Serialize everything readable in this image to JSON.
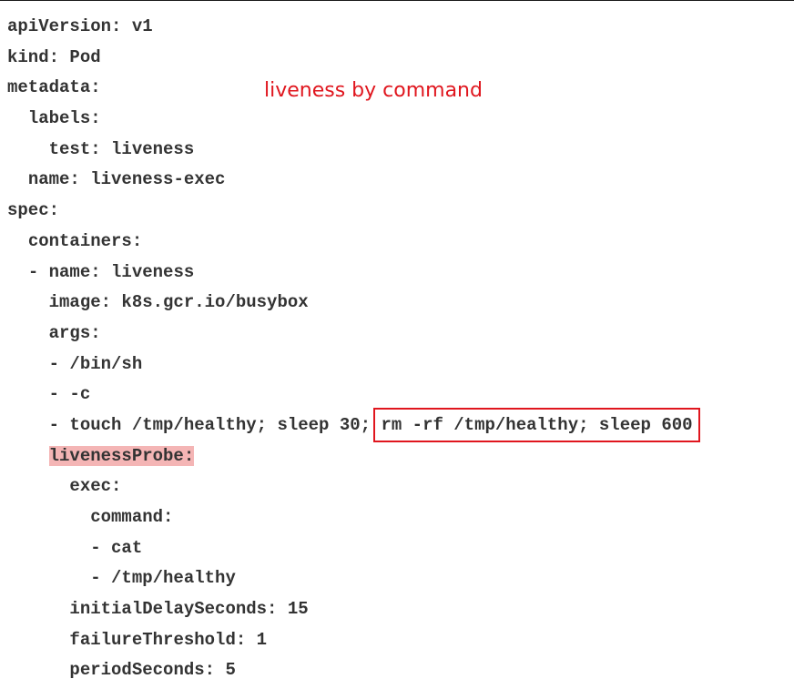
{
  "annotation": {
    "text": "liveness by command",
    "color": "#e0161e"
  },
  "code": {
    "lines": [
      {
        "indent": "",
        "text": "apiVersion: v1"
      },
      {
        "indent": "",
        "text": "kind: Pod"
      },
      {
        "indent": "",
        "text": "metadata:"
      },
      {
        "indent": "  ",
        "text": "labels:"
      },
      {
        "indent": "    ",
        "text": "test: liveness"
      },
      {
        "indent": "  ",
        "text": "name: liveness-exec"
      },
      {
        "indent": "",
        "text": "spec:"
      },
      {
        "indent": "  ",
        "text": "containers:"
      },
      {
        "indent": "  ",
        "text": "- name: liveness"
      },
      {
        "indent": "    ",
        "text": "image: k8s.gcr.io/busybox"
      },
      {
        "indent": "    ",
        "text": "args:"
      },
      {
        "indent": "    ",
        "text": "- /bin/sh"
      },
      {
        "indent": "    ",
        "text": "- -c"
      },
      {
        "indent": "    ",
        "text": "- touch /tmp/healthy; sleep 30; ",
        "boxed": "rm -rf /tmp/healthy; sleep 600"
      },
      {
        "indent": "    ",
        "text": "livenessProbe:",
        "highlight": true
      },
      {
        "indent": "      ",
        "text": "exec:"
      },
      {
        "indent": "        ",
        "text": "command:"
      },
      {
        "indent": "        ",
        "text": "- cat"
      },
      {
        "indent": "        ",
        "text": "- /tmp/healthy"
      },
      {
        "indent": "      ",
        "text": "initialDelaySeconds: 15"
      },
      {
        "indent": "      ",
        "text": "failureThreshold: 1"
      },
      {
        "indent": "      ",
        "text": "periodSeconds: 5"
      }
    ]
  },
  "colors": {
    "code_text": "#333333",
    "highlight_bg": "#f4b5b5",
    "box_border": "#e0161e"
  }
}
